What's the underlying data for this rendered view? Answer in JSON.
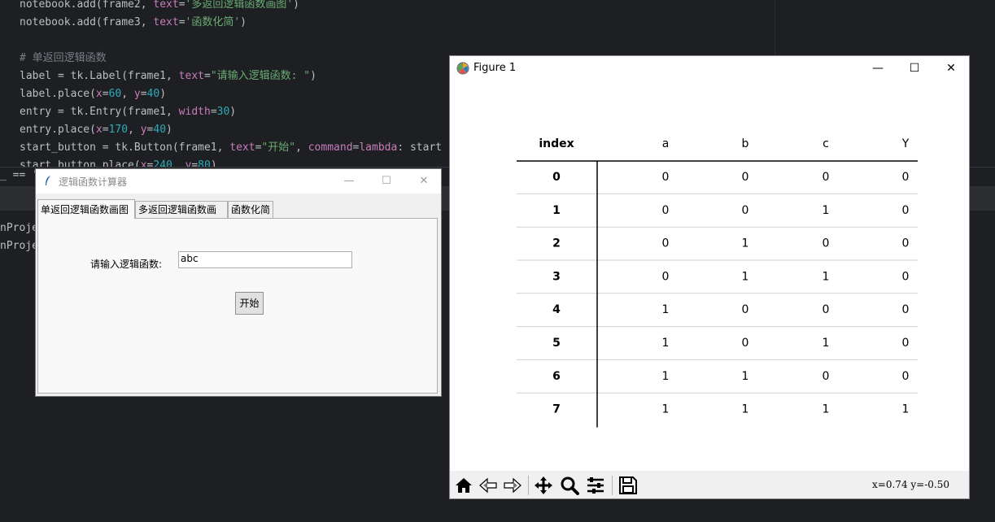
{
  "ide": {
    "code_lines": [
      {
        "tokens": [
          [
            "call",
            "notebook.add(frame2, "
          ],
          [
            "kw",
            "text"
          ],
          [
            "call",
            "="
          ],
          [
            "str",
            "'多返回逻辑函数画图'"
          ],
          [
            "call",
            ")"
          ]
        ]
      },
      {
        "tokens": [
          [
            "call",
            "notebook.add(frame3, "
          ],
          [
            "kw",
            "text"
          ],
          [
            "call",
            "="
          ],
          [
            "str",
            "'函数化简'"
          ],
          [
            "call",
            ")"
          ]
        ]
      },
      {
        "tokens": []
      },
      {
        "tokens": [
          [
            "com",
            "# 单返回逻辑函数"
          ]
        ]
      },
      {
        "tokens": [
          [
            "call",
            "label = tk.Label(frame1, "
          ],
          [
            "kw",
            "text"
          ],
          [
            "call",
            "="
          ],
          [
            "str",
            "\"请输入逻辑函数: \""
          ],
          [
            "call",
            ")"
          ]
        ]
      },
      {
        "tokens": [
          [
            "call",
            "label.place("
          ],
          [
            "kw",
            "x"
          ],
          [
            "call",
            "="
          ],
          [
            "num",
            "60"
          ],
          [
            "call",
            ", "
          ],
          [
            "kw",
            "y"
          ],
          [
            "call",
            "="
          ],
          [
            "num",
            "40"
          ],
          [
            "call",
            ")"
          ]
        ]
      },
      {
        "tokens": [
          [
            "call",
            "entry = tk.Entry(frame1, "
          ],
          [
            "kw",
            "width"
          ],
          [
            "call",
            "="
          ],
          [
            "num",
            "30"
          ],
          [
            "call",
            ")"
          ]
        ]
      },
      {
        "tokens": [
          [
            "call",
            "entry.place("
          ],
          [
            "kw",
            "x"
          ],
          [
            "call",
            "="
          ],
          [
            "num",
            "170"
          ],
          [
            "call",
            ", "
          ],
          [
            "kw",
            "y"
          ],
          [
            "call",
            "="
          ],
          [
            "num",
            "40"
          ],
          [
            "call",
            ")"
          ]
        ]
      },
      {
        "tokens": [
          [
            "call",
            "start_button = tk.Button(frame1, "
          ],
          [
            "kw",
            "text"
          ],
          [
            "call",
            "="
          ],
          [
            "str",
            "\"开始\""
          ],
          [
            "call",
            ", "
          ],
          [
            "kw",
            "command"
          ],
          [
            "call",
            "="
          ],
          [
            "kw",
            "lambda"
          ],
          [
            "call",
            ": start"
          ]
        ]
      },
      {
        "tokens": [
          [
            "call",
            "start_button.place("
          ],
          [
            "kw",
            "x"
          ],
          [
            "call",
            "="
          ],
          [
            "num",
            "240"
          ],
          [
            "call",
            ", "
          ],
          [
            "kw",
            "y"
          ],
          [
            "call",
            "="
          ],
          [
            "num",
            "80"
          ],
          [
            "call",
            ")"
          ]
        ]
      }
    ],
    "run_lines": [
      "_ == '_",
      "nProje",
      "nProje"
    ]
  },
  "tk_window": {
    "title": "逻辑函数计算器",
    "minimize": "—",
    "maximize": "☐",
    "close": "✕",
    "tabs": [
      "单返回逻辑函数画图",
      "多返回逻辑函数画图",
      "函数化简"
    ],
    "label": "请输入逻辑函数:",
    "entry_value": "abc",
    "button": "开始"
  },
  "figure_window": {
    "title": "Figure 1",
    "minimize": "—",
    "maximize": "☐",
    "close": "✕",
    "coords": "x=0.74 y=-0.50",
    "toolbar_icons": [
      "home-icon",
      "back-icon",
      "forward-icon",
      "pan-icon",
      "zoom-icon",
      "configure-subplots-icon",
      "save-icon"
    ]
  },
  "chart_data": {
    "type": "table",
    "columns": [
      "index",
      "a",
      "b",
      "c",
      "Y"
    ],
    "rows": [
      [
        "0",
        "0",
        "0",
        "0",
        "0"
      ],
      [
        "1",
        "0",
        "0",
        "1",
        "0"
      ],
      [
        "2",
        "0",
        "1",
        "0",
        "0"
      ],
      [
        "3",
        "0",
        "1",
        "1",
        "0"
      ],
      [
        "4",
        "1",
        "0",
        "0",
        "0"
      ],
      [
        "5",
        "1",
        "0",
        "1",
        "0"
      ],
      [
        "6",
        "1",
        "1",
        "0",
        "0"
      ],
      [
        "7",
        "1",
        "1",
        "1",
        "1"
      ]
    ]
  }
}
